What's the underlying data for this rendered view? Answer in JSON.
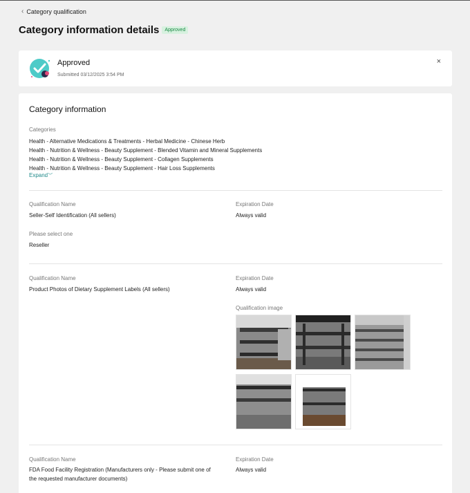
{
  "nav": {
    "back_label": "Category qualification"
  },
  "page": {
    "title": "Category information details",
    "badge": "Approved"
  },
  "status": {
    "title": "Approved",
    "submitted": "Submitted 03/12/2025 3:54 PM",
    "close": "×"
  },
  "section": {
    "title": "Category information",
    "categories_label": "Categories",
    "categories": [
      "Health - Alternative Medications & Treatments - Herbal Medicine - Chinese Herb",
      "Health - Nutrition & Wellness - Beauty Supplement - Blended Vitamin and Mineral Supplements",
      "Health - Nutrition & Wellness - Beauty Supplement - Collagen Supplements",
      "Health - Nutrition & Wellness - Beauty Supplement - Hair Loss Supplements"
    ],
    "expand_label": "Expand"
  },
  "qualifications": [
    {
      "name_label": "Qualification Name",
      "name": "Seller-Self Identification (All sellers)",
      "exp_label": "Expiration Date",
      "exp": "Always valid",
      "select_label": "Please select one",
      "select_value": "Reseller"
    },
    {
      "name_label": "Qualification Name",
      "name": "Product Photos of Dietary Supplement Labels (All sellers)",
      "exp_label": "Expiration Date",
      "exp": "Always valid",
      "image_label": "Qualification image"
    },
    {
      "name_label": "Qualification Name",
      "name_line1": "FDA Food Facility Registration (Manufacturers only - Please submit one of",
      "name_line2": "the requested manufacturer documents)",
      "exp_label": "Expiration Date",
      "exp": "Always valid"
    }
  ],
  "colors": {
    "badge_bg": "#d7f1df",
    "badge_text": "#1a8a45",
    "link": "#1f8a8a",
    "icon_teal": "#4ecbc8"
  },
  "icons": {
    "back": "chevron-left-icon",
    "status": "approved-check-icon",
    "close": "close-icon",
    "expand": "chevron-down-icon"
  }
}
